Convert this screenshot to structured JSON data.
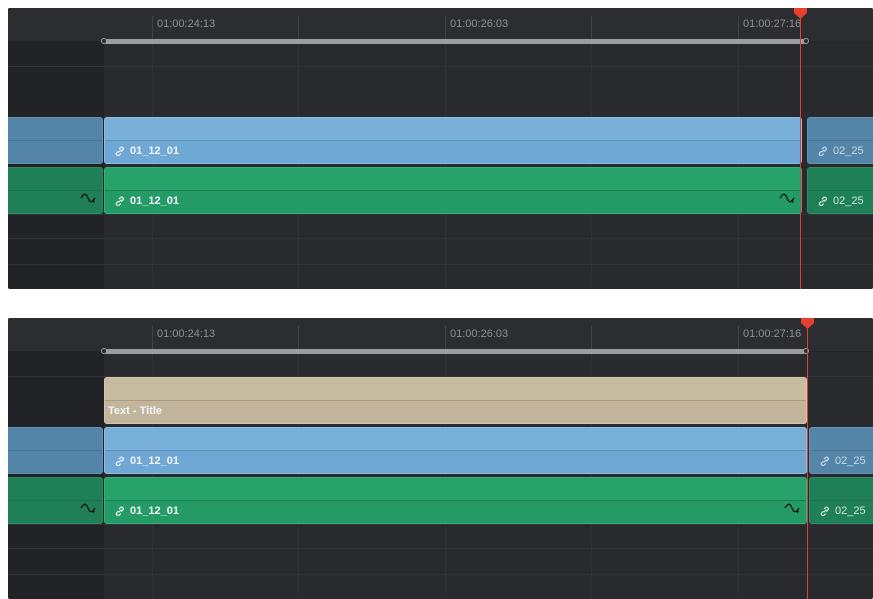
{
  "colors": {
    "video_clip": "#6fa8d4",
    "audio_clip": "#249b66",
    "title_clip": "#c2b59b",
    "playhead": "#e0402f",
    "timeline_bg": "#282a2d"
  },
  "panels": [
    {
      "timecodes": [
        "01:00:24:13",
        "01:00:26:03",
        "01:00:27:16"
      ],
      "video_clip": {
        "label": "01_12_01"
      },
      "video_next": {
        "label": "02_25"
      },
      "audio_clip": {
        "label": "01_12_01"
      },
      "audio_next": {
        "label": "02_25"
      }
    },
    {
      "timecodes": [
        "01:00:24:13",
        "01:00:26:03",
        "01:00:27:16"
      ],
      "title_clip": {
        "label": "Text - Title"
      },
      "video_clip": {
        "label": "01_12_01"
      },
      "video_next": {
        "label": "02_25"
      },
      "audio_clip": {
        "label": "01_12_01"
      },
      "audio_next": {
        "label": "02_25"
      }
    }
  ],
  "icons": {
    "link": "link-icon",
    "audio_fade": "audio-fade-icon",
    "playhead": "playhead-marker-icon"
  }
}
